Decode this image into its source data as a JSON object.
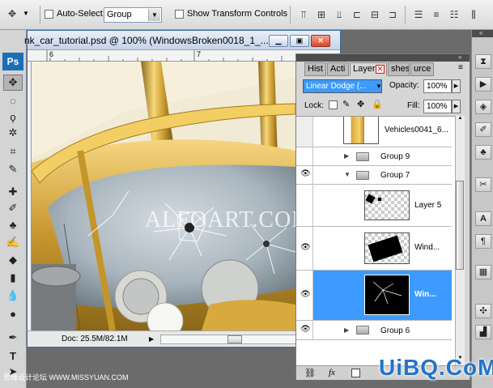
{
  "options_bar": {
    "auto_select_label": "Auto-Select:",
    "auto_select_value": "Group",
    "show_transform_label": "Show Transform Controls"
  },
  "document": {
    "title": "nk_car_tutorial.psd @ 100% (WindowsBroken0018_1_...",
    "ruler_marks": [
      "6",
      "7"
    ],
    "status": "Doc: 25.5M/82.1M",
    "watermark": "ALFOART.COM"
  },
  "panel": {
    "tabs": [
      "Hist",
      "Acti",
      "Layers",
      "shes",
      "urce"
    ],
    "blend_mode": "Linear Dodge (...",
    "opacity_label": "Opacity:",
    "opacity_value": "100%",
    "lock_label": "Lock:",
    "fill_label": "Fill:",
    "fill_value": "100%",
    "layers": [
      {
        "name": "Vehicles0041_6...",
        "visible": false
      },
      {
        "name": "Group 9",
        "visible": false
      },
      {
        "name": "Group 7",
        "visible": true
      },
      {
        "name": "Layer 5",
        "visible": false
      },
      {
        "name": "Wind...",
        "visible": true
      },
      {
        "name": "Win...",
        "visible": true,
        "selected": true
      },
      {
        "name": "Group 6",
        "visible": true
      }
    ],
    "footer_icon": "fx"
  },
  "watermarks": {
    "bottom_left": "思缘设计论坛 WWW.MISSYUAN.COM",
    "bottom_right": "UiBQ.CoM"
  },
  "colors": {
    "selection": "#3d9bff",
    "brand_blue": "#1a6fb7"
  }
}
